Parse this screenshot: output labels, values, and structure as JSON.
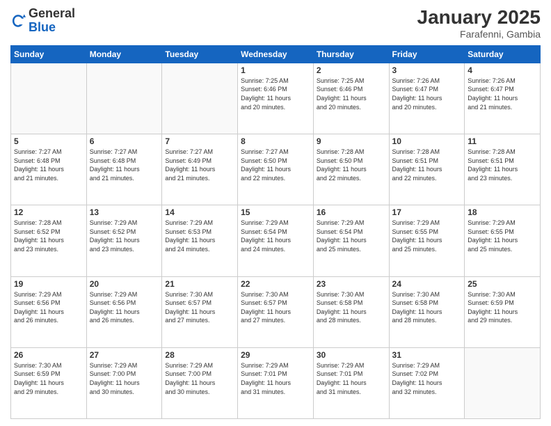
{
  "header": {
    "logo_general": "General",
    "logo_blue": "Blue",
    "title": "January 2025",
    "subtitle": "Farafenni, Gambia"
  },
  "days_of_week": [
    "Sunday",
    "Monday",
    "Tuesday",
    "Wednesday",
    "Thursday",
    "Friday",
    "Saturday"
  ],
  "weeks": [
    [
      {
        "day": "",
        "info": ""
      },
      {
        "day": "",
        "info": ""
      },
      {
        "day": "",
        "info": ""
      },
      {
        "day": "1",
        "info": "Sunrise: 7:25 AM\nSunset: 6:46 PM\nDaylight: 11 hours\nand 20 minutes."
      },
      {
        "day": "2",
        "info": "Sunrise: 7:25 AM\nSunset: 6:46 PM\nDaylight: 11 hours\nand 20 minutes."
      },
      {
        "day": "3",
        "info": "Sunrise: 7:26 AM\nSunset: 6:47 PM\nDaylight: 11 hours\nand 20 minutes."
      },
      {
        "day": "4",
        "info": "Sunrise: 7:26 AM\nSunset: 6:47 PM\nDaylight: 11 hours\nand 21 minutes."
      }
    ],
    [
      {
        "day": "5",
        "info": "Sunrise: 7:27 AM\nSunset: 6:48 PM\nDaylight: 11 hours\nand 21 minutes."
      },
      {
        "day": "6",
        "info": "Sunrise: 7:27 AM\nSunset: 6:48 PM\nDaylight: 11 hours\nand 21 minutes."
      },
      {
        "day": "7",
        "info": "Sunrise: 7:27 AM\nSunset: 6:49 PM\nDaylight: 11 hours\nand 21 minutes."
      },
      {
        "day": "8",
        "info": "Sunrise: 7:27 AM\nSunset: 6:50 PM\nDaylight: 11 hours\nand 22 minutes."
      },
      {
        "day": "9",
        "info": "Sunrise: 7:28 AM\nSunset: 6:50 PM\nDaylight: 11 hours\nand 22 minutes."
      },
      {
        "day": "10",
        "info": "Sunrise: 7:28 AM\nSunset: 6:51 PM\nDaylight: 11 hours\nand 22 minutes."
      },
      {
        "day": "11",
        "info": "Sunrise: 7:28 AM\nSunset: 6:51 PM\nDaylight: 11 hours\nand 23 minutes."
      }
    ],
    [
      {
        "day": "12",
        "info": "Sunrise: 7:28 AM\nSunset: 6:52 PM\nDaylight: 11 hours\nand 23 minutes."
      },
      {
        "day": "13",
        "info": "Sunrise: 7:29 AM\nSunset: 6:52 PM\nDaylight: 11 hours\nand 23 minutes."
      },
      {
        "day": "14",
        "info": "Sunrise: 7:29 AM\nSunset: 6:53 PM\nDaylight: 11 hours\nand 24 minutes."
      },
      {
        "day": "15",
        "info": "Sunrise: 7:29 AM\nSunset: 6:54 PM\nDaylight: 11 hours\nand 24 minutes."
      },
      {
        "day": "16",
        "info": "Sunrise: 7:29 AM\nSunset: 6:54 PM\nDaylight: 11 hours\nand 25 minutes."
      },
      {
        "day": "17",
        "info": "Sunrise: 7:29 AM\nSunset: 6:55 PM\nDaylight: 11 hours\nand 25 minutes."
      },
      {
        "day": "18",
        "info": "Sunrise: 7:29 AM\nSunset: 6:55 PM\nDaylight: 11 hours\nand 25 minutes."
      }
    ],
    [
      {
        "day": "19",
        "info": "Sunrise: 7:29 AM\nSunset: 6:56 PM\nDaylight: 11 hours\nand 26 minutes."
      },
      {
        "day": "20",
        "info": "Sunrise: 7:29 AM\nSunset: 6:56 PM\nDaylight: 11 hours\nand 26 minutes."
      },
      {
        "day": "21",
        "info": "Sunrise: 7:30 AM\nSunset: 6:57 PM\nDaylight: 11 hours\nand 27 minutes."
      },
      {
        "day": "22",
        "info": "Sunrise: 7:30 AM\nSunset: 6:57 PM\nDaylight: 11 hours\nand 27 minutes."
      },
      {
        "day": "23",
        "info": "Sunrise: 7:30 AM\nSunset: 6:58 PM\nDaylight: 11 hours\nand 28 minutes."
      },
      {
        "day": "24",
        "info": "Sunrise: 7:30 AM\nSunset: 6:58 PM\nDaylight: 11 hours\nand 28 minutes."
      },
      {
        "day": "25",
        "info": "Sunrise: 7:30 AM\nSunset: 6:59 PM\nDaylight: 11 hours\nand 29 minutes."
      }
    ],
    [
      {
        "day": "26",
        "info": "Sunrise: 7:30 AM\nSunset: 6:59 PM\nDaylight: 11 hours\nand 29 minutes."
      },
      {
        "day": "27",
        "info": "Sunrise: 7:29 AM\nSunset: 7:00 PM\nDaylight: 11 hours\nand 30 minutes."
      },
      {
        "day": "28",
        "info": "Sunrise: 7:29 AM\nSunset: 7:00 PM\nDaylight: 11 hours\nand 30 minutes."
      },
      {
        "day": "29",
        "info": "Sunrise: 7:29 AM\nSunset: 7:01 PM\nDaylight: 11 hours\nand 31 minutes."
      },
      {
        "day": "30",
        "info": "Sunrise: 7:29 AM\nSunset: 7:01 PM\nDaylight: 11 hours\nand 31 minutes."
      },
      {
        "day": "31",
        "info": "Sunrise: 7:29 AM\nSunset: 7:02 PM\nDaylight: 11 hours\nand 32 minutes."
      },
      {
        "day": "",
        "info": ""
      }
    ]
  ]
}
